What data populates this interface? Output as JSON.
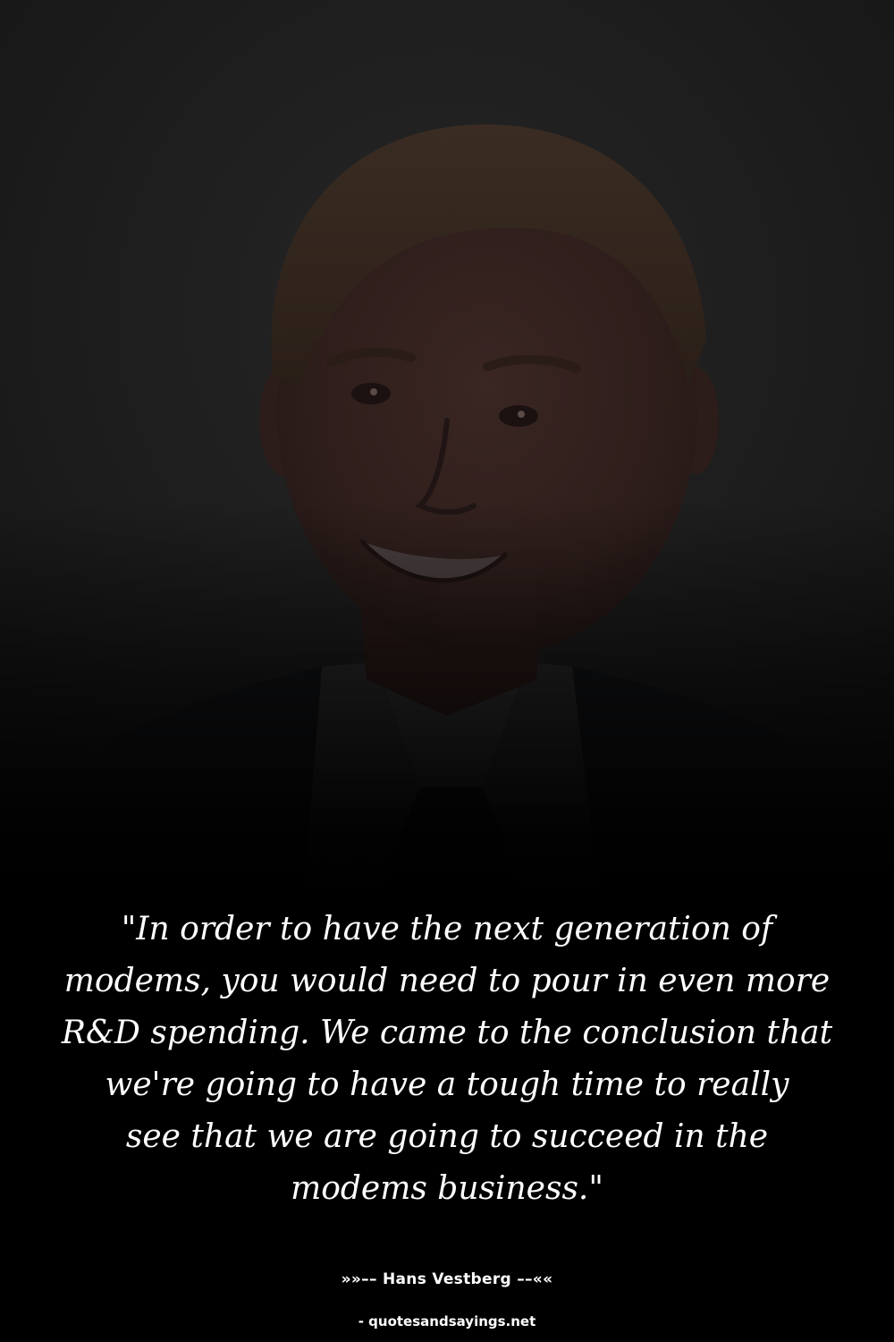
{
  "quote": {
    "lines": [
      "\"In order to have the next generation of",
      "modems, you would need to pour in even more",
      "R&D spending. We came to the conclusion that",
      "we're going to have a tough time to really",
      "see that we are going to succeed in the",
      "modems business.\""
    ]
  },
  "author": {
    "text": "»»–– Hans Vestberg ––««"
  },
  "source": {
    "text": "- quotesandsayings.net"
  },
  "photo": {
    "subject": "smiling man portrait"
  },
  "colors": {
    "background": "#1c1c1c",
    "text": "#ffffff"
  }
}
